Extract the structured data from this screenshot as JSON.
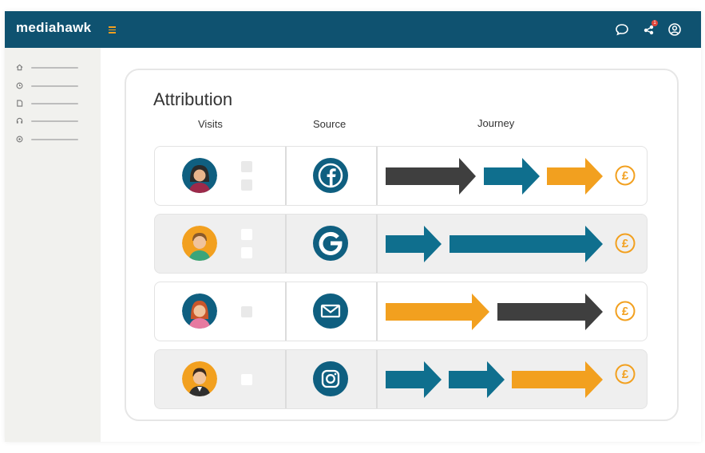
{
  "app": {
    "brand": "mediahawk"
  },
  "colors": {
    "header": "#0f5270",
    "accent": "#f2a01f",
    "teal": "#0f6f8e",
    "dark": "#3f3f3f"
  },
  "header": {
    "icons": [
      "chat-icon",
      "notifications-icon",
      "profile-icon"
    ],
    "notification_badge": "1"
  },
  "sidebar": {
    "items": [
      {
        "icon": "home-icon"
      },
      {
        "icon": "clock-icon"
      },
      {
        "icon": "document-icon"
      },
      {
        "icon": "headset-icon"
      },
      {
        "icon": "settings-icon"
      }
    ]
  },
  "main": {
    "title": "Attribution",
    "columns": {
      "visits": "Visits",
      "source": "Source",
      "journey": "Journey"
    },
    "rows": [
      {
        "visitor": "woman-dark-hair",
        "source": "facebook-icon",
        "journey": [
          "dark",
          "teal",
          "orange"
        ],
        "outcome": "£"
      },
      {
        "visitor": "man-orange-bg",
        "source": "google-icon",
        "journey": [
          "teal",
          "teal"
        ],
        "outcome": "£"
      },
      {
        "visitor": "woman-red-hair",
        "source": "email-icon",
        "journey": [
          "orange",
          "dark"
        ],
        "outcome": "£"
      },
      {
        "visitor": "man-suit",
        "source": "instagram-icon",
        "journey": [
          "teal",
          "teal",
          "orange"
        ],
        "outcome": "£"
      }
    ]
  }
}
